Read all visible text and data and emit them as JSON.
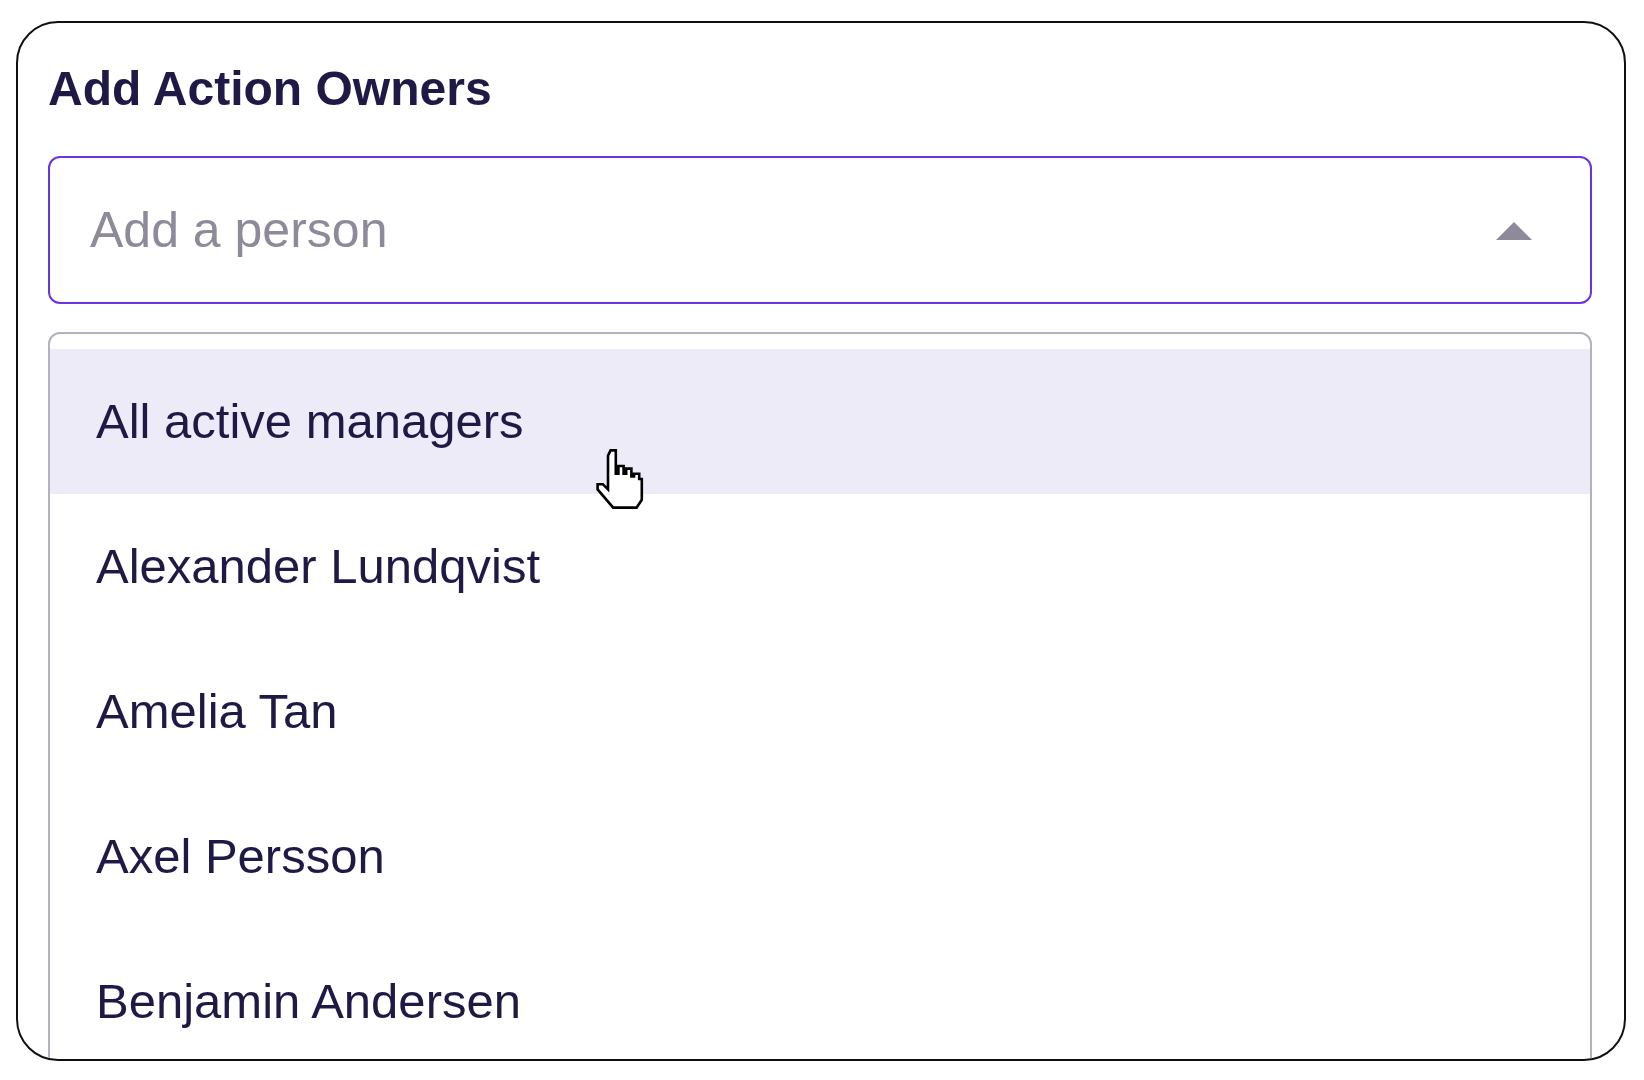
{
  "title": "Add Action Owners",
  "field": {
    "placeholder": "Add a person",
    "expanded": true
  },
  "options": [
    {
      "label": "All active managers",
      "highlighted": true
    },
    {
      "label": "Alexander Lundqvist",
      "highlighted": false
    },
    {
      "label": "Amelia Tan",
      "highlighted": false
    },
    {
      "label": "Axel Persson",
      "highlighted": false
    },
    {
      "label": "Benjamin Andersen",
      "highlighted": false
    }
  ]
}
